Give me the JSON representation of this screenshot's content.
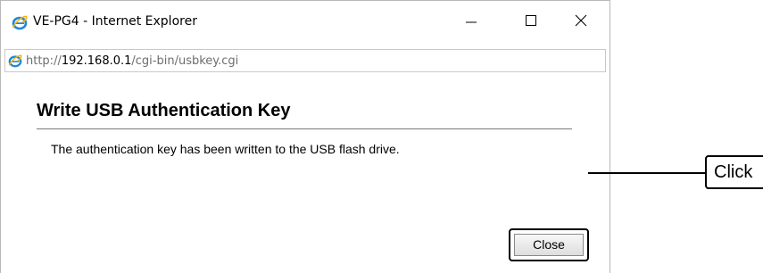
{
  "window": {
    "title": "VE-PG4 - Internet Explorer",
    "icon": "internet-explorer-icon",
    "controls": {
      "minimize_icon": "minimize-icon",
      "maximize_icon": "maximize-icon",
      "close_icon": "close-icon"
    }
  },
  "address_bar": {
    "icon": "internet-explorer-icon",
    "url_prefix": "http://",
    "url_host": "192.168.0.1",
    "url_path": "/cgi-bin/usbkey.cgi"
  },
  "page": {
    "heading": "Write USB Authentication Key",
    "message": "The authentication key has been written to the USB flash drive.",
    "close_button_label": "Close"
  },
  "callout": {
    "text": "Click"
  },
  "colors": {
    "ie_blue": "#1e88d9",
    "ie_gold": "#f2b50f",
    "window_border": "#b9b9b9",
    "rule": "#7a7a7a"
  }
}
